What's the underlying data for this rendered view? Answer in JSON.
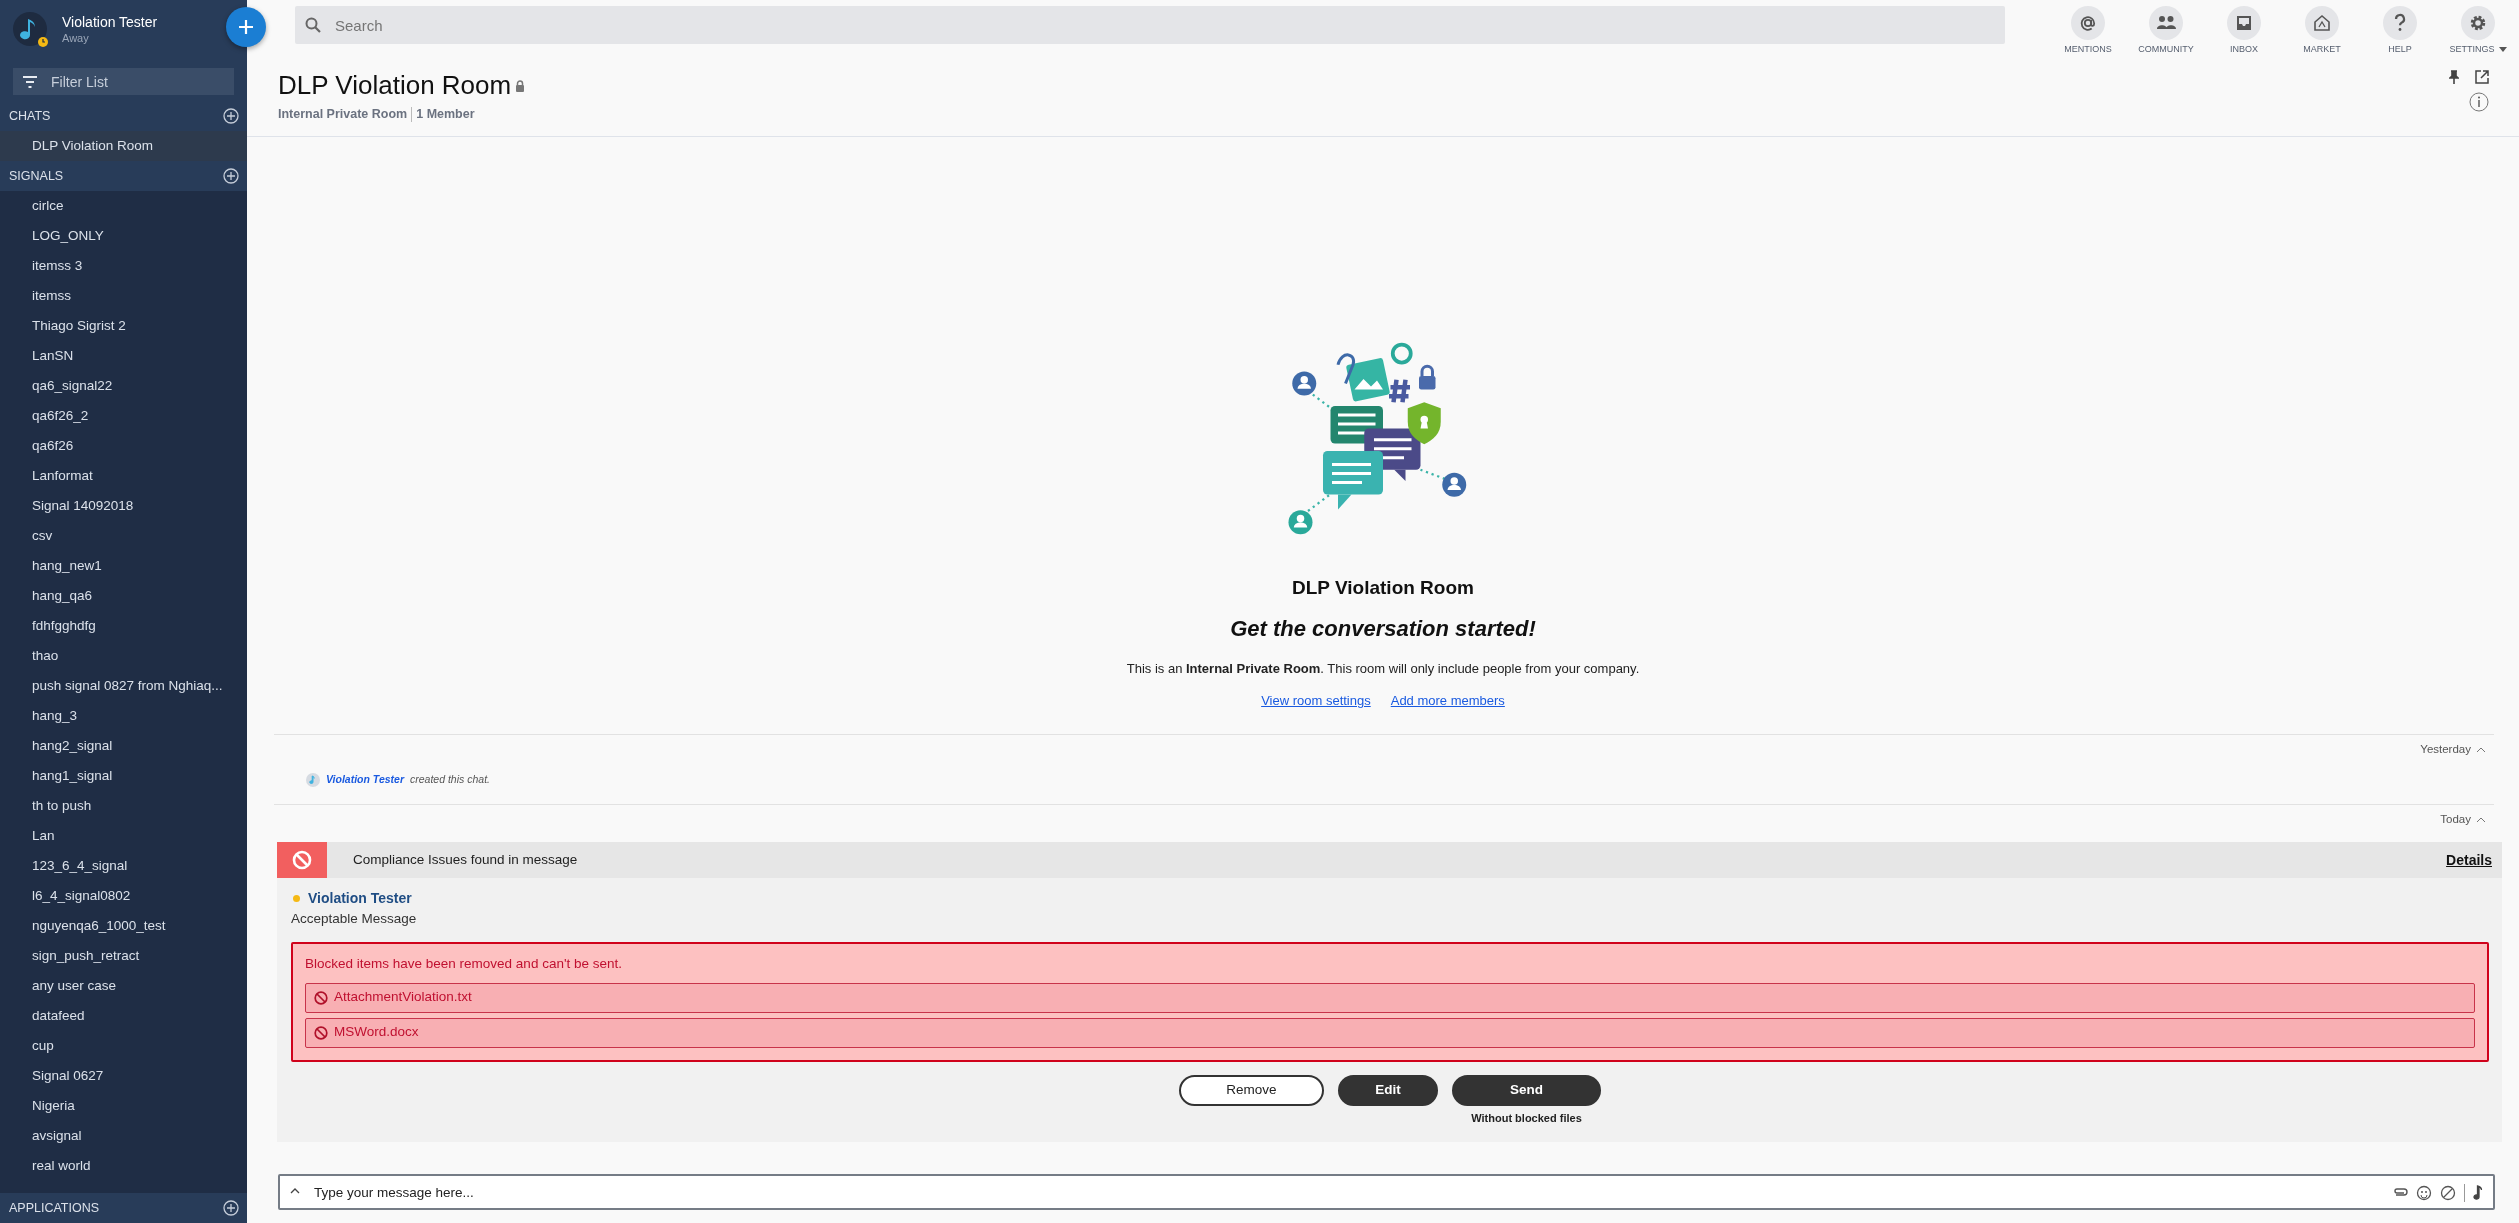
{
  "user": {
    "name": "Violation Tester",
    "status": "Away"
  },
  "search": {
    "placeholder": "Search"
  },
  "toolbar": [
    {
      "label": "MENTIONS",
      "kind": "mentions"
    },
    {
      "label": "COMMUNITY",
      "kind": "community"
    },
    {
      "label": "INBOX",
      "kind": "inbox"
    },
    {
      "label": "MARKET",
      "kind": "market"
    },
    {
      "label": "HELP",
      "kind": "help"
    },
    {
      "label": "SETTINGS",
      "kind": "settings"
    }
  ],
  "sidebar": {
    "filter": {
      "placeholder": "Filter List"
    },
    "sections": [
      {
        "title": "CHATS",
        "items": [
          {
            "label": "DLP Violation Room",
            "selected": true
          }
        ]
      },
      {
        "title": "SIGNALS",
        "items": [
          {
            "label": "cirlce",
            "selected": false
          },
          {
            "label": "LOG_ONLY",
            "selected": false
          },
          {
            "label": "itemss 3",
            "selected": false
          },
          {
            "label": "itemss",
            "selected": false
          },
          {
            "label": "Thiago Sigrist 2",
            "selected": false
          },
          {
            "label": "LanSN",
            "selected": false
          },
          {
            "label": "qa6_signal22",
            "selected": false
          },
          {
            "label": "qa6f26_2",
            "selected": false
          },
          {
            "label": "qa6f26",
            "selected": false
          },
          {
            "label": "Lanformat",
            "selected": false
          },
          {
            "label": "Signal 14092018",
            "selected": false
          },
          {
            "label": "csv",
            "selected": false
          },
          {
            "label": "hang_new1",
            "selected": false
          },
          {
            "label": "hang_qa6",
            "selected": false
          },
          {
            "label": "fdhfgghdfg",
            "selected": false
          },
          {
            "label": "thao",
            "selected": false
          },
          {
            "label": "push signal 0827 from Nghiaq...",
            "selected": false
          },
          {
            "label": "hang_3",
            "selected": false
          },
          {
            "label": "hang2_signal",
            "selected": false
          },
          {
            "label": "hang1_signal",
            "selected": false
          },
          {
            "label": "th to push",
            "selected": false
          },
          {
            "label": "Lan",
            "selected": false
          },
          {
            "label": "123_6_4_signal",
            "selected": false
          },
          {
            "label": "l6_4_signal0802",
            "selected": false
          },
          {
            "label": "nguyenqa6_1000_test",
            "selected": false
          },
          {
            "label": "sign_push_retract",
            "selected": false
          },
          {
            "label": "any user case",
            "selected": false
          },
          {
            "label": "datafeed",
            "selected": false
          },
          {
            "label": "cup",
            "selected": false
          },
          {
            "label": "Signal 0627",
            "selected": false
          },
          {
            "label": "Nigeria",
            "selected": false
          },
          {
            "label": "avsignal",
            "selected": false
          },
          {
            "label": "real world",
            "selected": false
          }
        ]
      },
      {
        "title": "APPLICATIONS"
      }
    ]
  },
  "room": {
    "title": "DLP Violation Room",
    "locked": true,
    "type": "Internal Private Room",
    "members": "1 Member"
  },
  "empty_state": {
    "title": "DLP Violation Room",
    "heading": "Get the conversation started!",
    "text": "This is an **Internal Private Room**. This room will only include people from your company.",
    "links": [
      "View room settings",
      "Add more members"
    ]
  },
  "timeline": [
    {
      "kind": "divider",
      "label": "Yesterday"
    },
    {
      "kind": "event",
      "user": "Violation Tester",
      "text": "created this chat."
    },
    {
      "kind": "divider",
      "label": "Today"
    },
    {
      "kind": "compliance",
      "banner": "Compliance Issues found in message",
      "details": "Details",
      "sender": "Violation Tester",
      "message": "Acceptable Message",
      "notice": "Blocked items have been removed and can't be sent.",
      "files": [
        "AttachmentViolation.txt",
        "MSWord.docx"
      ],
      "buttons": [
        {
          "label": "Remove",
          "kind": "outline"
        },
        {
          "label": "Edit",
          "kind": "dark"
        },
        {
          "label": "Send",
          "kind": "dark",
          "caption": "Without blocked files"
        }
      ]
    }
  ],
  "composer": {
    "placeholder": "Type your message here..."
  }
}
